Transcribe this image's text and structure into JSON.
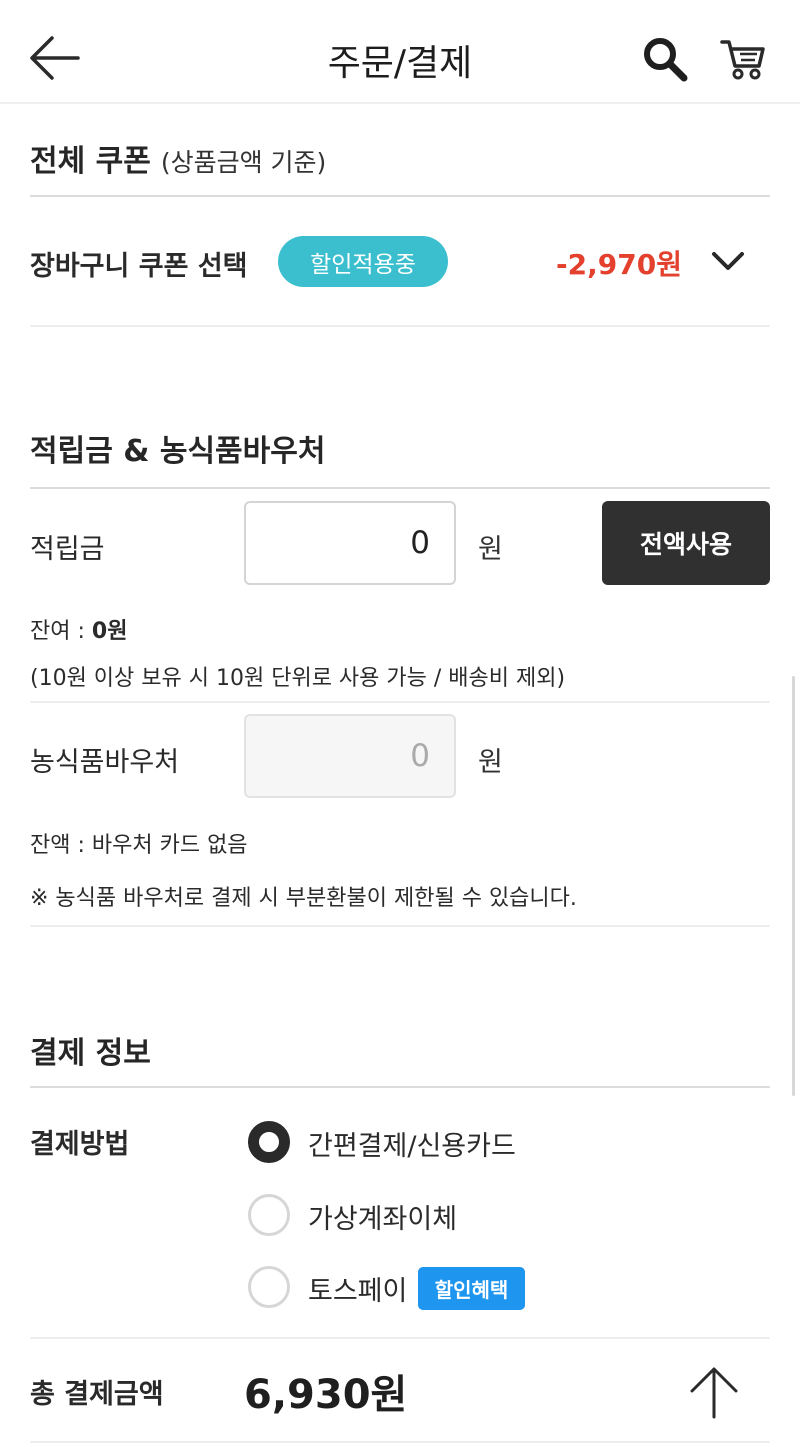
{
  "header": {
    "title": "주문/결제",
    "back_icon": "arrow-left-icon",
    "search_icon": "search-icon",
    "cart_icon": "cart-icon"
  },
  "coupon": {
    "title": "전체 쿠폰",
    "subtitle": "(상품금액 기준)",
    "row_label": "장바구니 쿠폰 선택",
    "badge": "할인적용중",
    "discount": "-2,970원",
    "badge_color": "#3bbfcf",
    "discount_color": "#e4402e"
  },
  "points": {
    "title": "적립금 & 농식품바우처",
    "points_label": "적립금",
    "points_value": "0",
    "unit": "원",
    "use_all_label": "전액사용",
    "balance_prefix": "잔여 : ",
    "balance_value": "0원",
    "note": "(10원 이상 보유 시 10원 단위로 사용 가능 / 배송비 제외)",
    "voucher_label": "농식품바우처",
    "voucher_value": "0",
    "voucher_balance": "잔액 : 바우처 카드 없음",
    "voucher_note": "※ 농식품 바우처로 결제 시 부분환불이 제한될 수 있습니다."
  },
  "payment": {
    "title": "결제 정보",
    "method_label": "결제방법",
    "methods": [
      {
        "label": "간편결제/신용카드",
        "checked": true
      },
      {
        "label": "가상계좌이체",
        "checked": false
      },
      {
        "label": "토스페이",
        "checked": false
      }
    ],
    "benefit_badge": "할인혜택",
    "benefit_color": "#1e95ee"
  },
  "total": {
    "label": "총 결제금액",
    "amount": "6,930원",
    "top_icon": "arrow-up-icon"
  }
}
